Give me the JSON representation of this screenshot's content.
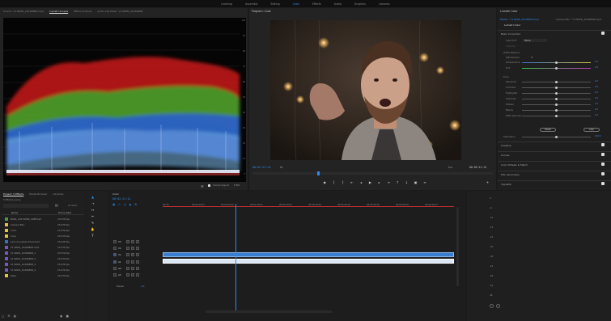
{
  "workspaces": [
    "Learning",
    "Assembly",
    "Editing",
    "Color",
    "Effects",
    "Audio",
    "Graphics",
    "Libraries"
  ],
  "active_workspace": "Color",
  "scopes_panel": {
    "tabs": [
      "Source: V1 BAML_20180808.mp4",
      "Lumetri Scopes",
      "Effect Controls",
      "Audio Clip Mixer: V1 BAML_20180808"
    ],
    "active_tab": "Lumetri Scopes",
    "scale": [
      "100",
      "90",
      "80",
      "70",
      "60",
      "50",
      "40",
      "30",
      "20",
      "10",
      "0"
    ],
    "bottom_label": "Clamp Signal",
    "bottom_value": "8 Bit"
  },
  "program_monitor": {
    "title": "Program: Color",
    "timecode": "00:02:21:14",
    "fit": "Fit",
    "quality": "Full",
    "duration": "00:09:21:15",
    "playhead_fraction": 0.27
  },
  "lumetri": {
    "panel_title": "Lumetri Color",
    "clip_source": "Master * V1 BAML_20180808.mp4",
    "clip_target": "Camera Blur * V1 BAML_20180808.mp4",
    "subtab": "Lumetri Color",
    "basic_correction": "Basic Correction",
    "input_lut_label": "Input LUT",
    "input_lut_value": "None",
    "intensity_label": "Intensity",
    "white_balance": "White Balance",
    "wb_selector": "WB Selector",
    "tone": "Tone",
    "reset": "Reset",
    "auto": "Auto",
    "saturation_label": "Saturation",
    "saturation_value": "100.0",
    "hdr_specular": "HDR Specular",
    "wb_params": [
      {
        "label": "Temperature",
        "value": "0.0",
        "pos": 0.5
      },
      {
        "label": "Tint",
        "value": "0.0",
        "pos": 0.5
      }
    ],
    "tone_params": [
      {
        "label": "Exposure",
        "value": "0.0",
        "pos": 0.5
      },
      {
        "label": "Contrast",
        "value": "0.0",
        "pos": 0.5
      },
      {
        "label": "Highlights",
        "value": "0.0",
        "pos": 0.5
      },
      {
        "label": "Shadows",
        "value": "0.0",
        "pos": 0.5
      },
      {
        "label": "Whites",
        "value": "0.0",
        "pos": 0.5
      },
      {
        "label": "Blacks",
        "value": "0.0",
        "pos": 0.5
      },
      {
        "label": "HDR Specular",
        "value": "0.0",
        "pos": 0.5
      }
    ],
    "sections": [
      "Creative",
      "Curves",
      "Color Wheels & Match",
      "HSL Secondary",
      "Vignette"
    ]
  },
  "project_panel": {
    "tabs": [
      "Project: 5 Effects",
      "Media Browser",
      "Libraries"
    ],
    "project_file": "5 Effects.prproj",
    "item_count": "15 Items",
    "header_name": "Name",
    "header_rate": "Frame Rate",
    "items": [
      {
        "name": "BAML_20170808_CRBFresh",
        "rate": "23.976 fps",
        "color": "#4a9a4a"
      },
      {
        "name": "Camera Blur",
        "rate": "23.976 fps",
        "color": "#e0c44a"
      },
      {
        "name": "Color",
        "rate": "23.976 fps",
        "color": "#e0c44a"
      },
      {
        "name": "Crop",
        "rate": "23.976 fps",
        "color": "#e0c44a"
      },
      {
        "name": "Lens Curvature Final.mp4",
        "rate": "23.976 fps",
        "color": "#3a6fc4"
      },
      {
        "name": "V1 BAML_20180808.mp4",
        "rate": "23.976 fps",
        "color": "#7a55c4"
      },
      {
        "name": "V1 BAML_20180808_1",
        "rate": "23.976 fps",
        "color": "#7a55c4"
      },
      {
        "name": "V1 BAML_20180808_2",
        "rate": "23.976 fps",
        "color": "#7a55c4"
      },
      {
        "name": "V1 BAML_20180808_3",
        "rate": "23.976 fps",
        "color": "#7a55c4"
      },
      {
        "name": "V1 BAML_20180808_4",
        "rate": "23.976 fps",
        "color": "#7a55c4"
      },
      {
        "name": "Warp",
        "rate": "23.976 fps",
        "color": "#e0c44a"
      }
    ]
  },
  "timeline": {
    "sequence": "Color",
    "timecode": "00:02:21:14",
    "ruler": [
      "00:00",
      "00:00:29:23",
      "00:00:59:22",
      "00:01:29:21",
      "00:01:59:21",
      "00:02:29:20",
      "00:02:59:19",
      "00:03:29:18",
      "00:03:59:18",
      "00:04:29:17"
    ],
    "tracks_video": [
      "V3",
      "V2",
      "V1"
    ],
    "tracks_audio": [
      "A1",
      "A2",
      "A3"
    ],
    "master_label": "Master",
    "master_value": "0.0",
    "playhead_fraction": 0.25,
    "video_clip_start": 0.0,
    "video_clip_end": 1.0
  },
  "meters": {
    "scale": [
      "0",
      "-6",
      "-12",
      "-18",
      "-24",
      "-30",
      "-36",
      "-42",
      "-48",
      "-54",
      "dB"
    ]
  }
}
